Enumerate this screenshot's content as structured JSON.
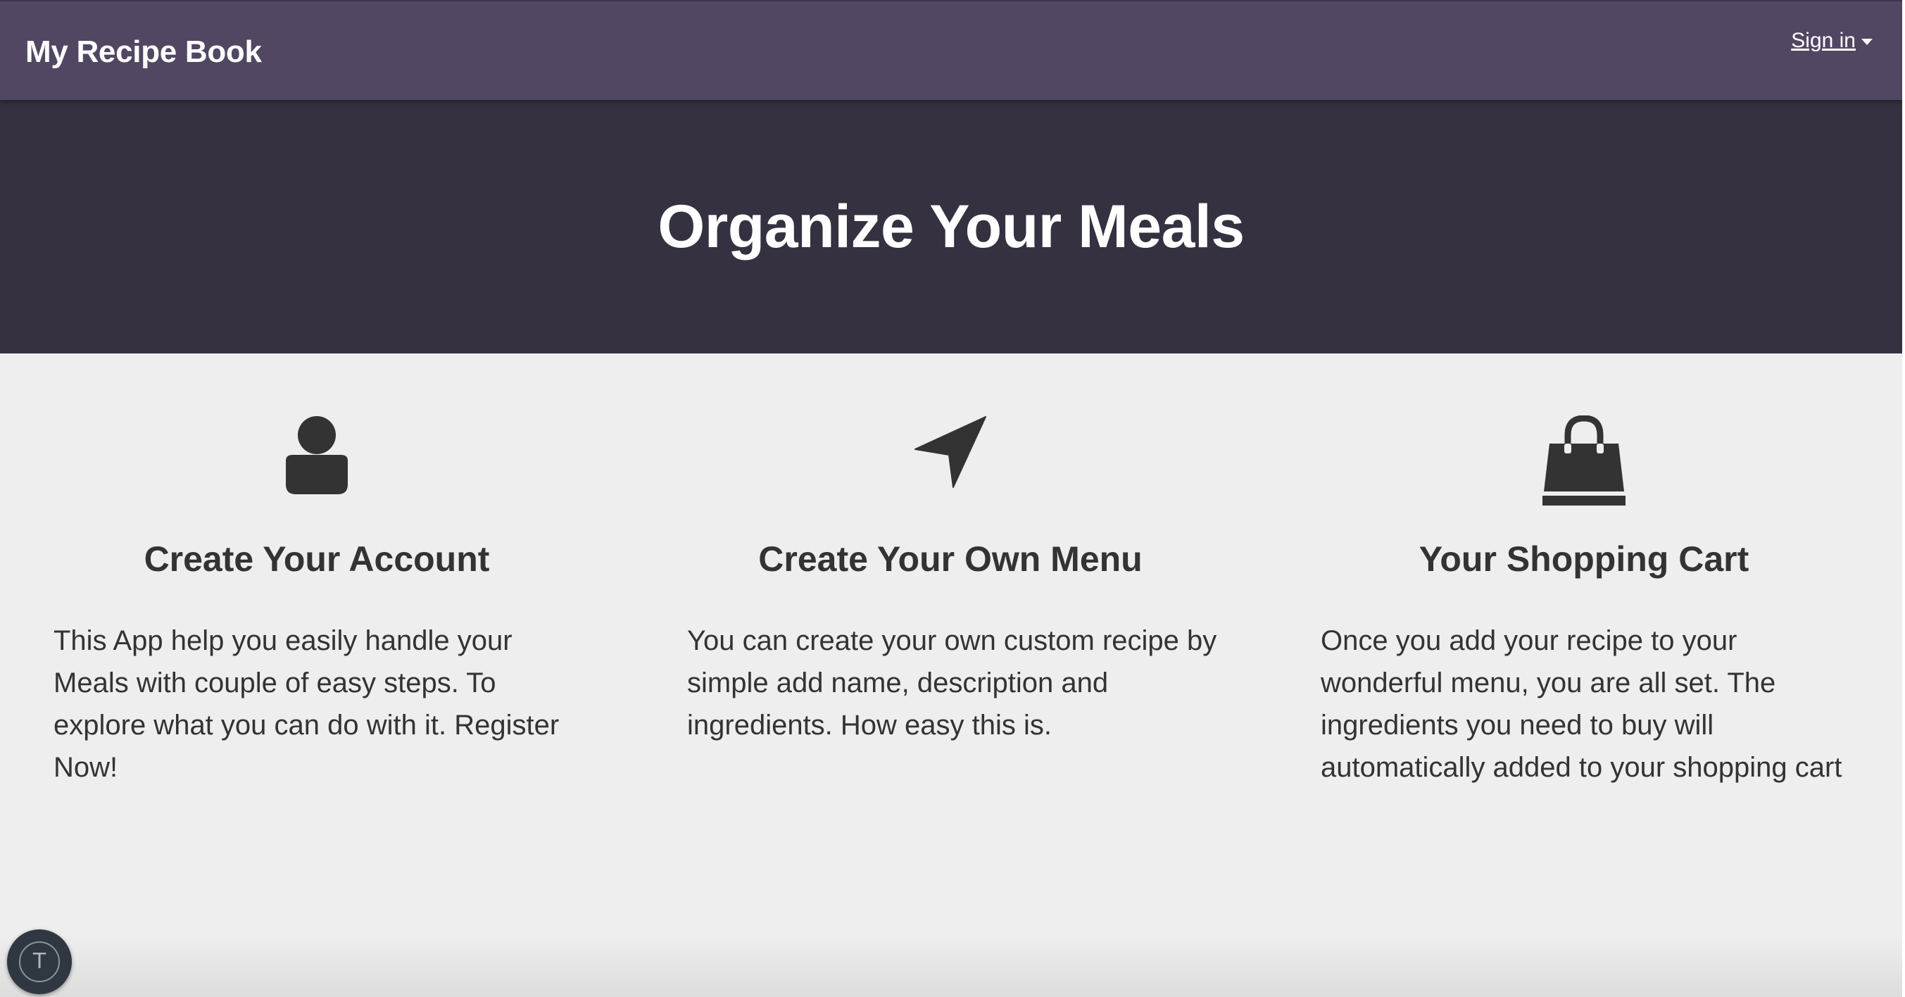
{
  "navbar": {
    "brand": "My Recipe Book",
    "signin_label": "Sign in"
  },
  "hero": {
    "title": "Organize Your Meals"
  },
  "features": [
    {
      "icon": "user-icon",
      "title": "Create Your Account",
      "text": "This App help you easily handle your Meals with couple of easy steps. To explore what you can do with it. Register Now!"
    },
    {
      "icon": "location-arrow-icon",
      "title": "Create Your Own Menu",
      "text": "You can create your own custom recipe by simple add name, description and ingredients. How easy this is."
    },
    {
      "icon": "shopping-bag-icon",
      "title": "Your Shopping Cart",
      "text": "Once you add your recipe to your wonderful menu, you are all set. The ingredients you need to buy will automatically added to your shopping cart"
    }
  ],
  "floating_button": {
    "label": "T"
  },
  "colors": {
    "navbar": "#524763",
    "hero": "#353141",
    "background": "#eeeeee",
    "text": "#333333"
  }
}
